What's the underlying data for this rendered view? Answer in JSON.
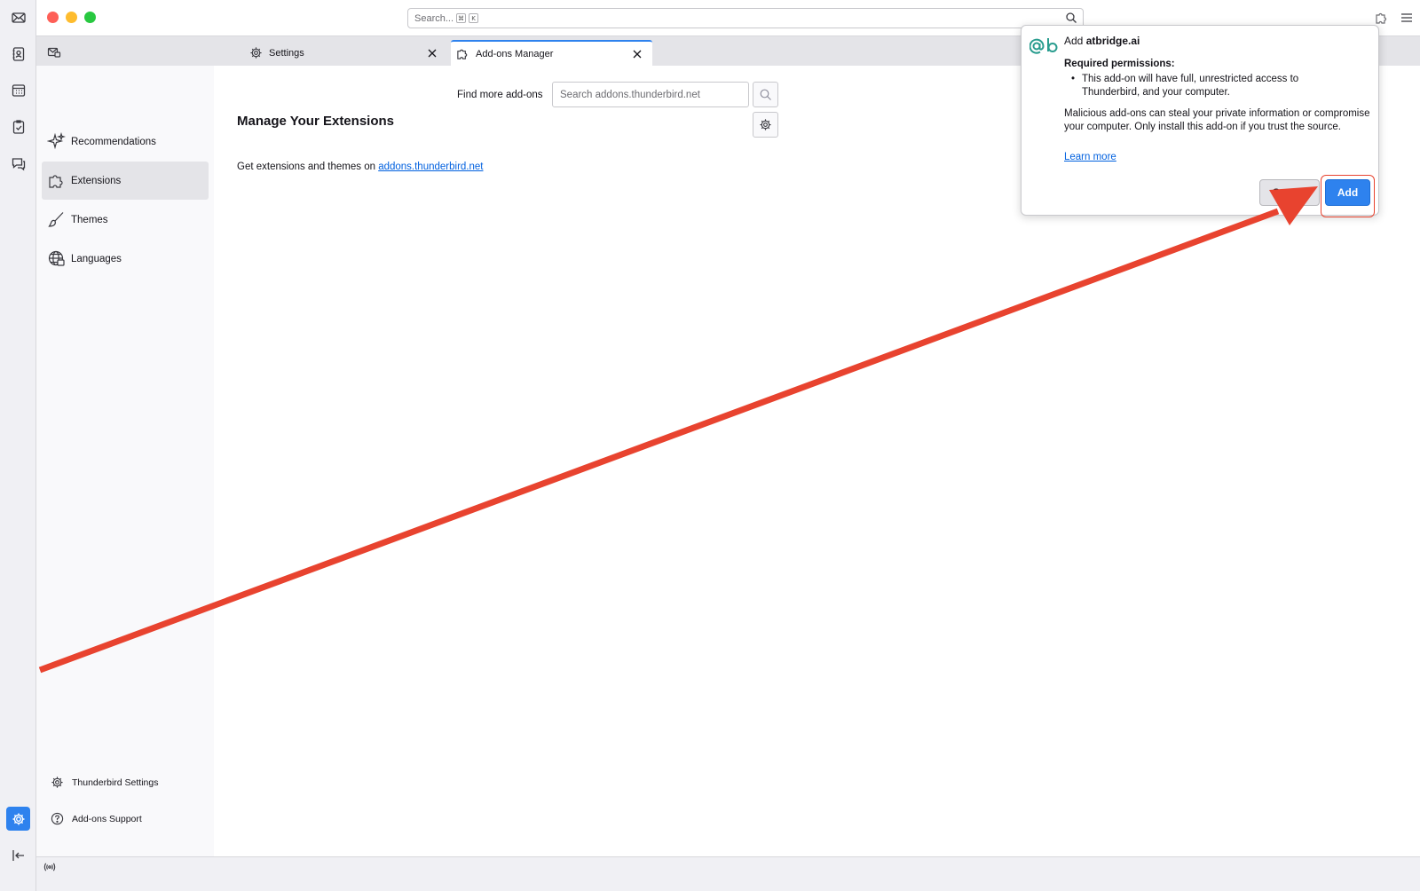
{
  "titlebar": {
    "search_placeholder": "Search...",
    "shortcut_cmd": "⌘",
    "shortcut_key": "K"
  },
  "tabs": [
    {
      "label": "Settings",
      "icon": "gear-icon"
    },
    {
      "label": "Add-ons Manager",
      "icon": "puzzle-icon"
    }
  ],
  "categories": [
    {
      "label": "Recommendations",
      "icon": "sparkle-icon"
    },
    {
      "label": "Extensions",
      "icon": "puzzle-icon"
    },
    {
      "label": "Themes",
      "icon": "brush-icon"
    },
    {
      "label": "Languages",
      "icon": "globe-icon"
    }
  ],
  "footer": {
    "settings_label": "Thunderbird Settings",
    "support_label": "Add-ons Support"
  },
  "main": {
    "find_more_label": "Find more add-ons",
    "search_placeholder": "Search addons.thunderbird.net",
    "title": "Manage Your Extensions",
    "hint_text": "Get extensions and themes on ",
    "hint_link": "addons.thunderbird.net"
  },
  "popup": {
    "heading_prefix": "Add ",
    "addon_name": "atbridge.ai",
    "required_label": "Required permissions:",
    "permission": "This add-on will have full, unrestricted access to Thunderbird, and your computer.",
    "warning": "Malicious add-ons can steal your private information or compromise your computer. Only install this add-on if you trust the source.",
    "learn_more": "Learn more",
    "cancel_label": "Cancel",
    "add_label": "Add"
  },
  "colors": {
    "accent": "#2e82ee",
    "annotation": "#e8432f",
    "addon_icon": "#2a9d8f"
  }
}
